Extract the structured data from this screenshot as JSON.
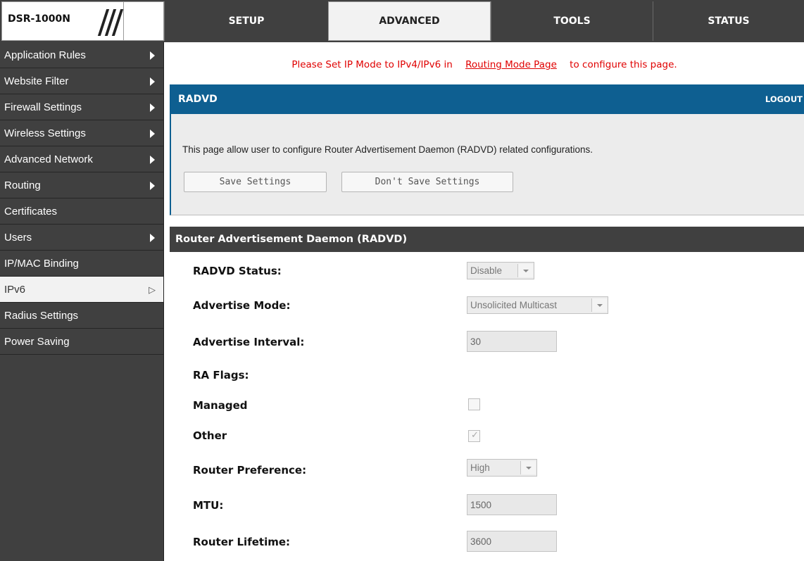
{
  "header": {
    "model": "DSR-1000N",
    "tabs": [
      {
        "label": "SETUP"
      },
      {
        "label": "ADVANCED"
      },
      {
        "label": "TOOLS"
      },
      {
        "label": "STATUS"
      }
    ]
  },
  "sidebar": {
    "items": [
      {
        "label": "Application Rules"
      },
      {
        "label": "Website Filter"
      },
      {
        "label": "Firewall Settings"
      },
      {
        "label": "Wireless Settings"
      },
      {
        "label": "Advanced Network"
      },
      {
        "label": "Routing"
      },
      {
        "label": "Certificates"
      },
      {
        "label": "Users"
      },
      {
        "label": "IP/MAC Binding"
      },
      {
        "label": "IPv6"
      },
      {
        "label": "Radius Settings"
      },
      {
        "label": "Power Saving"
      }
    ]
  },
  "notice": {
    "before": "Please Set IP Mode to IPv4/IPv6 in",
    "link": "Routing Mode Page",
    "after": "to configure this page."
  },
  "radvd": {
    "title": "RADVD",
    "logout": "LOGOUT",
    "description": "This page allow user to configure Router Advertisement Daemon (RADVD) related configurations.",
    "save_label": "Save Settings",
    "dont_save_label": "Don't Save Settings"
  },
  "section": {
    "title": "Router Advertisement Daemon (RADVD)"
  },
  "fields": {
    "status": {
      "label": "RADVD Status:",
      "value": "Disable"
    },
    "mode": {
      "label": "Advertise Mode:",
      "value": "Unsolicited Multicast"
    },
    "interval": {
      "label": "Advertise Interval:",
      "value": "30"
    },
    "ra_flags": {
      "label": "RA Flags:"
    },
    "managed": {
      "label": "Managed",
      "checked": false
    },
    "other": {
      "label": "Other",
      "checked": true
    },
    "preference": {
      "label": "Router Preference:",
      "value": "High"
    },
    "mtu": {
      "label": "MTU:",
      "value": "1500"
    },
    "lifetime": {
      "label": "Router Lifetime:",
      "value": "3600"
    }
  }
}
